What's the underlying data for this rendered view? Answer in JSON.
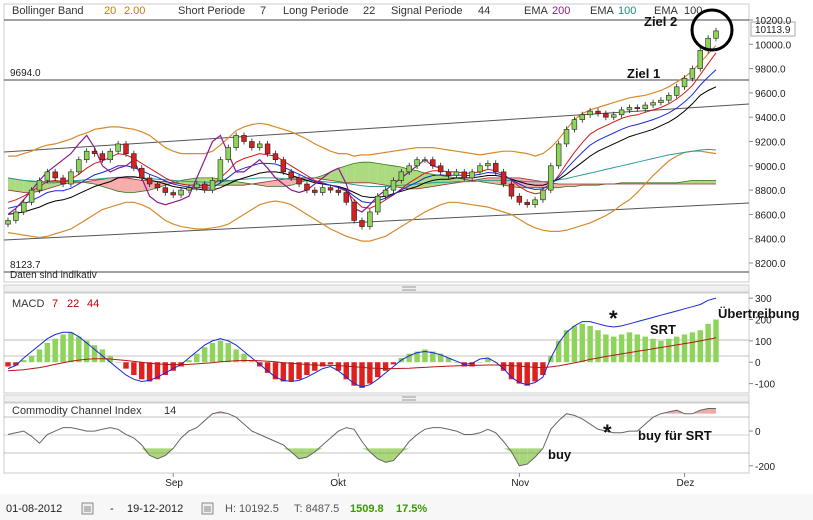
{
  "chart_data": [
    {
      "type": "candlestick",
      "title": "",
      "ylim": [
        8100,
        10250
      ],
      "yticks": [
        "10200.0",
        "10000.0",
        "9800.0",
        "9600.0",
        "9400.0",
        "9200.0",
        "9000.0",
        "8800.0",
        "8600.0",
        "8400.0",
        "8200.0"
      ],
      "price_labels": {
        "last": "10113.9",
        "level": "9694.0",
        "low": "8123.7"
      },
      "indicators": {
        "bollinger": {
          "label": "Bollinger Band",
          "p1": "20",
          "p2": "2.00"
        },
        "short": {
          "label": "Short Periode",
          "value": "7"
        },
        "long": {
          "label": "Long Periode",
          "value": "22"
        },
        "signal": {
          "label": "Signal Periode",
          "value": "44"
        },
        "ema1": {
          "label": "EMA",
          "value": "200",
          "color": "#8b1a8b"
        },
        "ema2": {
          "label": "EMA",
          "value": "100",
          "color": "#1a8b8b"
        },
        "ema3": {
          "label": "EMA",
          "value": "100",
          "color": "#000000"
        }
      },
      "notice": "Daten sind indikativ",
      "annotations": {
        "ziel1": "Ziel 1",
        "ziel2": "Ziel 2"
      },
      "close": [
        8550,
        8620,
        8700,
        8800,
        8880,
        8950,
        8900,
        8850,
        8950,
        9050,
        9120,
        9100,
        9050,
        9120,
        9180,
        9100,
        8980,
        8900,
        8850,
        8820,
        8780,
        8760,
        8800,
        8820,
        8850,
        8800,
        8880,
        9050,
        9150,
        9250,
        9200,
        9150,
        9180,
        9100,
        9050,
        8950,
        8900,
        8850,
        8800,
        8780,
        8820,
        8800,
        8780,
        8700,
        8550,
        8500,
        8620,
        8750,
        8800,
        8880,
        8950,
        9000,
        9050,
        9050,
        9000,
        8950,
        8920,
        8950,
        8900,
        8950,
        9000,
        9020,
        8950,
        8850,
        8750,
        8700,
        8680,
        8720,
        8800,
        9000,
        9180,
        9300,
        9380,
        9420,
        9450,
        9430,
        9400,
        9420,
        9460,
        9480,
        9470,
        9500,
        9520,
        9540,
        9580,
        9650,
        9720,
        9800,
        9950,
        10050,
        10110
      ],
      "bb_upper": [
        9080,
        9080,
        9100,
        9120,
        9150,
        9170,
        9180,
        9200,
        9220,
        9250,
        9270,
        9300,
        9310,
        9320,
        9320,
        9310,
        9300,
        9280,
        9250,
        9200,
        9150,
        9120,
        9100,
        9100,
        9100,
        9100,
        9120,
        9170,
        9230,
        9290,
        9320,
        9340,
        9350,
        9340,
        9320,
        9300,
        9280,
        9250,
        9220,
        9180,
        9150,
        9120,
        9100,
        9100,
        9080,
        9090,
        9090,
        9100,
        9110,
        9120,
        9130,
        9140,
        9150,
        9150,
        9150,
        9140,
        9130,
        9120,
        9110,
        9100,
        9090,
        9100,
        9110,
        9120,
        9120,
        9110,
        9100,
        9080,
        9100,
        9150,
        9220,
        9300,
        9380,
        9430,
        9460,
        9480,
        9500,
        9520,
        9540,
        9560,
        9570,
        9580,
        9600,
        9620,
        9650,
        9690,
        9730,
        9780,
        9850,
        9920,
        9990
      ],
      "bb_lower": [
        8450,
        8440,
        8430,
        8420,
        8410,
        8420,
        8440,
        8460,
        8480,
        8520,
        8560,
        8600,
        8640,
        8660,
        8680,
        8700,
        8700,
        8680,
        8650,
        8600,
        8550,
        8520,
        8500,
        8490,
        8480,
        8480,
        8490,
        8500,
        8520,
        8560,
        8600,
        8640,
        8680,
        8700,
        8710,
        8700,
        8680,
        8640,
        8600,
        8560,
        8520,
        8480,
        8450,
        8420,
        8400,
        8380,
        8380,
        8400,
        8420,
        8460,
        8500,
        8540,
        8580,
        8620,
        8650,
        8680,
        8700,
        8700,
        8690,
        8680,
        8670,
        8660,
        8640,
        8620,
        8600,
        8560,
        8520,
        8490,
        8470,
        8460,
        8460,
        8470,
        8490,
        8510,
        8530,
        8560,
        8590,
        8630,
        8680,
        8720,
        8780,
        8850,
        8920,
        8980,
        9040,
        9080,
        9110,
        9120,
        9120,
        9110,
        9100
      ],
      "ema_fast": [
        8700,
        8720,
        8750,
        8790,
        8830,
        8870,
        8880,
        8870,
        8890,
        8930,
        8980,
        9020,
        9040,
        9070,
        9100,
        9090,
        9060,
        9020,
        8980,
        8940,
        8900,
        8870,
        8850,
        8840,
        8840,
        8830,
        8840,
        8900,
        8960,
        9030,
        9060,
        9080,
        9100,
        9090,
        9080,
        9040,
        9000,
        8960,
        8920,
        8880,
        8860,
        8840,
        8820,
        8790,
        8720,
        8660,
        8650,
        8680,
        8720,
        8760,
        8810,
        8860,
        8900,
        8940,
        8960,
        8960,
        8950,
        8950,
        8940,
        8940,
        8950,
        8970,
        8960,
        8930,
        8880,
        8830,
        8790,
        8770,
        8780,
        8840,
        8920,
        9020,
        9110,
        9190,
        9260,
        9300,
        9330,
        9360,
        9390,
        9410,
        9420,
        9440,
        9460,
        9480,
        9510,
        9550,
        9600,
        9660,
        9750,
        9840,
        9930
      ],
      "ema_slow": [
        8600,
        8610,
        8620,
        8640,
        8660,
        8690,
        8710,
        8720,
        8740,
        8770,
        8800,
        8830,
        8850,
        8870,
        8900,
        8910,
        8910,
        8900,
        8880,
        8870,
        8850,
        8830,
        8820,
        8810,
        8810,
        8800,
        8800,
        8820,
        8850,
        8880,
        8900,
        8920,
        8940,
        8950,
        8950,
        8940,
        8920,
        8900,
        8880,
        8860,
        8850,
        8840,
        8830,
        8810,
        8780,
        8750,
        8740,
        8740,
        8750,
        8770,
        8790,
        8810,
        8830,
        8860,
        8880,
        8890,
        8890,
        8900,
        8900,
        8900,
        8910,
        8920,
        8920,
        8910,
        8890,
        8870,
        8850,
        8840,
        8840,
        8860,
        8890,
        8930,
        8980,
        9030,
        9080,
        9120,
        9150,
        9180,
        9210,
        9240,
        9260,
        9280,
        9300,
        9330,
        9360,
        9400,
        9450,
        9510,
        9580,
        9620,
        9650
      ],
      "ema_long": [
        8900,
        8890,
        8880,
        8875,
        8870,
        8870,
        8870,
        8870,
        8875,
        8880,
        8885,
        8890,
        8895,
        8900,
        8905,
        8905,
        8905,
        8900,
        8895,
        8890,
        8885,
        8880,
        8875,
        8870,
        8870,
        8865,
        8865,
        8870,
        8875,
        8885,
        8890,
        8895,
        8900,
        8900,
        8900,
        8895,
        8890,
        8885,
        8880,
        8875,
        8870,
        8865,
        8860,
        8855,
        8845,
        8835,
        8830,
        8830,
        8830,
        8835,
        8840,
        8845,
        8850,
        8855,
        8860,
        8865,
        8865,
        8870,
        8870,
        8870,
        8875,
        8880,
        8880,
        8880,
        8878,
        8875,
        8870,
        8868,
        8868,
        8875,
        8885,
        8895,
        8910,
        8925,
        8940,
        8955,
        8970,
        8985,
        9000,
        9015,
        9030,
        9045,
        9060,
        9075,
        9090,
        9100,
        9110,
        9120,
        9130,
        9135,
        9130
      ],
      "ichimoku_a": [
        8900,
        8890,
        8880,
        8870,
        8870,
        8860,
        8860,
        8870,
        8870,
        8870,
        8860,
        8850,
        8830,
        8810,
        8790,
        8780,
        8780,
        8790,
        8800,
        8820,
        8840,
        8860,
        8880,
        8890,
        8900,
        8900,
        8900,
        8890,
        8880,
        8870,
        8860,
        8850,
        8840,
        8830,
        8830,
        8830,
        8840,
        8860,
        8880,
        8900,
        8920,
        8950,
        8980,
        9000,
        9020,
        9030,
        9030,
        9020,
        9010,
        9000,
        8990,
        8970,
        8960,
        8940,
        8930,
        8920,
        8910,
        8900,
        8890,
        8880,
        8870,
        8860,
        8850,
        8840,
        8830,
        8820,
        8820,
        8820,
        8820,
        8820,
        8820,
        8830,
        8830,
        8840,
        8840,
        8840,
        8850,
        8850,
        8860,
        8860,
        8860,
        8860,
        8860,
        8860,
        8860,
        8860,
        8870,
        8880,
        8880,
        8880,
        8880
      ],
      "ichimoku_b": [
        8800,
        8790,
        8780,
        8780,
        8790,
        8810,
        8830,
        8850,
        8860,
        8860,
        8870,
        8880,
        8890,
        8900,
        8900,
        8900,
        8890,
        8880,
        8880,
        8870,
        8870,
        8860,
        8850,
        8840,
        8840,
        8840,
        8840,
        8840,
        8840,
        8840,
        8840,
        8850,
        8860,
        8870,
        8880,
        8890,
        8900,
        8900,
        8900,
        8900,
        8890,
        8880,
        8870,
        8860,
        8860,
        8860,
        8860,
        8850,
        8840,
        8830,
        8820,
        8810,
        8810,
        8820,
        8830,
        8840,
        8850,
        8860,
        8870,
        8880,
        8890,
        8900,
        8900,
        8900,
        8900,
        8900,
        8890,
        8880,
        8870,
        8860,
        8850,
        8850,
        8850,
        8850,
        8850,
        8850,
        8850,
        8850,
        8850,
        8850,
        8850,
        8850,
        8850,
        8850,
        8850,
        8850,
        8850,
        8850,
        8850,
        8850,
        8850
      ],
      "purple_line": [
        8600,
        8650,
        8720,
        8800,
        8880,
        8950,
        9000,
        9050,
        9100,
        9180,
        9250,
        9150,
        9000,
        8950,
        8980,
        9000,
        9050,
        8900,
        8750,
        8700,
        8680,
        8700,
        8720,
        8750,
        8900,
        9050,
        9200,
        9250,
        9100,
        8950,
        8950,
        9000,
        9050,
        8980,
        8900,
        8850,
        8800,
        8780,
        8800,
        8850,
        8900,
        8950,
        8980,
        8850,
        8650,
        8620,
        8680,
        8750,
        8800,
        8850,
        8900,
        8950,
        9000,
        9050,
        9000,
        8980,
        8900,
        8850,
        8880,
        8920,
        9000,
        9050,
        9100,
        9120,
        9080,
        9000,
        8900,
        8850,
        8880,
        9050,
        9250,
        9380,
        9450,
        9500,
        9550,
        9600,
        9650,
        9700,
        9750,
        9780,
        9800,
        9850,
        9900,
        10000,
        10100,
        10150,
        10200,
        10220,
        10250,
        10250,
        10250
      ]
    },
    {
      "type": "histogram",
      "title": "MACD",
      "params": [
        "7",
        "22",
        "44"
      ],
      "yticks": [
        "300",
        "200",
        "100",
        "0",
        "-100"
      ],
      "ylim": [
        -130,
        310
      ],
      "annotations": {
        "ubertreibung": "Übertreibung",
        "srt": "SRT",
        "star": "*"
      },
      "histogram": [
        -20,
        -15,
        10,
        30,
        60,
        90,
        110,
        130,
        140,
        120,
        100,
        80,
        60,
        30,
        0,
        -30,
        -60,
        -80,
        -90,
        -80,
        -60,
        -40,
        -20,
        10,
        40,
        70,
        90,
        100,
        90,
        60,
        40,
        10,
        -20,
        -50,
        -80,
        -90,
        -90,
        -80,
        -60,
        -40,
        -20,
        -10,
        -40,
        -80,
        -110,
        -120,
        -100,
        -70,
        -40,
        -10,
        20,
        40,
        50,
        60,
        50,
        40,
        20,
        0,
        -20,
        -20,
        0,
        20,
        0,
        -40,
        -80,
        -100,
        -110,
        -90,
        -60,
        30,
        100,
        150,
        170,
        180,
        170,
        150,
        130,
        120,
        130,
        140,
        130,
        120,
        110,
        100,
        110,
        120,
        130,
        140,
        150,
        180,
        200
      ],
      "macd_line": [
        -30,
        -15,
        20,
        50,
        80,
        110,
        130,
        140,
        140,
        120,
        90,
        60,
        30,
        0,
        -30,
        -60,
        -80,
        -90,
        -85,
        -70,
        -50,
        -30,
        -10,
        20,
        50,
        80,
        100,
        110,
        100,
        80,
        50,
        20,
        -10,
        -40,
        -70,
        -85,
        -90,
        -85,
        -70,
        -50,
        -30,
        -20,
        -40,
        -70,
        -100,
        -115,
        -105,
        -80,
        -50,
        -20,
        10,
        30,
        45,
        50,
        45,
        35,
        20,
        5,
        -10,
        -5,
        15,
        20,
        0,
        -30,
        -70,
        -95,
        -105,
        -95,
        -70,
        20,
        90,
        140,
        170,
        190,
        190,
        180,
        170,
        165,
        170,
        180,
        190,
        200,
        210,
        220,
        230,
        240,
        250,
        260,
        270,
        290,
        300
      ],
      "signal_line": [
        -40,
        -38,
        -35,
        -30,
        -25,
        -18,
        -10,
        -2,
        5,
        10,
        14,
        16,
        16,
        15,
        12,
        8,
        4,
        0,
        -5,
        -8,
        -10,
        -11,
        -11,
        -10,
        -8,
        -5,
        -2,
        2,
        5,
        7,
        8,
        8,
        7,
        5,
        2,
        -2,
        -5,
        -8,
        -11,
        -13,
        -14,
        -15,
        -16,
        -18,
        -21,
        -24,
        -27,
        -29,
        -30,
        -30,
        -29,
        -28,
        -26,
        -24,
        -22,
        -20,
        -18,
        -17,
        -16,
        -15,
        -14,
        -13,
        -13,
        -14,
        -16,
        -18,
        -21,
        -24,
        -25,
        -22,
        -17,
        -10,
        -3,
        5,
        13,
        20,
        27,
        33,
        39,
        45,
        51,
        57,
        63,
        69,
        75,
        81,
        87,
        93,
        100,
        107,
        115
      ]
    },
    {
      "type": "line",
      "title": "Commodity Channel Index",
      "params": [
        "14"
      ],
      "yticks": [
        "0",
        "-200"
      ],
      "ylim": [
        -230,
        150
      ],
      "xticks": [
        "Sep",
        "Okt",
        "Nov",
        "Dez"
      ],
      "annotations": {
        "buy": "buy",
        "buy_srt": "buy für SRT",
        "star": "*"
      },
      "values": [
        -20,
        -10,
        0,
        -30,
        -70,
        -20,
        0,
        20,
        20,
        10,
        0,
        0,
        10,
        20,
        10,
        -20,
        -40,
        -80,
        -140,
        -160,
        -140,
        -100,
        -40,
        0,
        20,
        60,
        100,
        110,
        100,
        80,
        40,
        0,
        -20,
        -40,
        -60,
        -80,
        -120,
        -160,
        -150,
        -120,
        -80,
        -40,
        0,
        20,
        10,
        -60,
        -120,
        -160,
        -180,
        -170,
        -120,
        -60,
        -20,
        10,
        20,
        20,
        10,
        0,
        -20,
        -20,
        -10,
        10,
        -10,
        -60,
        -120,
        -200,
        -190,
        -150,
        -100,
        10,
        60,
        100,
        90,
        70,
        40,
        10,
        0,
        -10,
        -10,
        0,
        0,
        40,
        80,
        100,
        110,
        120,
        100,
        100,
        120,
        130,
        130
      ]
    }
  ],
  "footer": {
    "from": "01-08-2012",
    "dash": "-",
    "to": "19-12-2012",
    "high": "H: 10192.5",
    "low": "T: 8487.5",
    "change": "1509.8",
    "pct": "17.5%"
  }
}
